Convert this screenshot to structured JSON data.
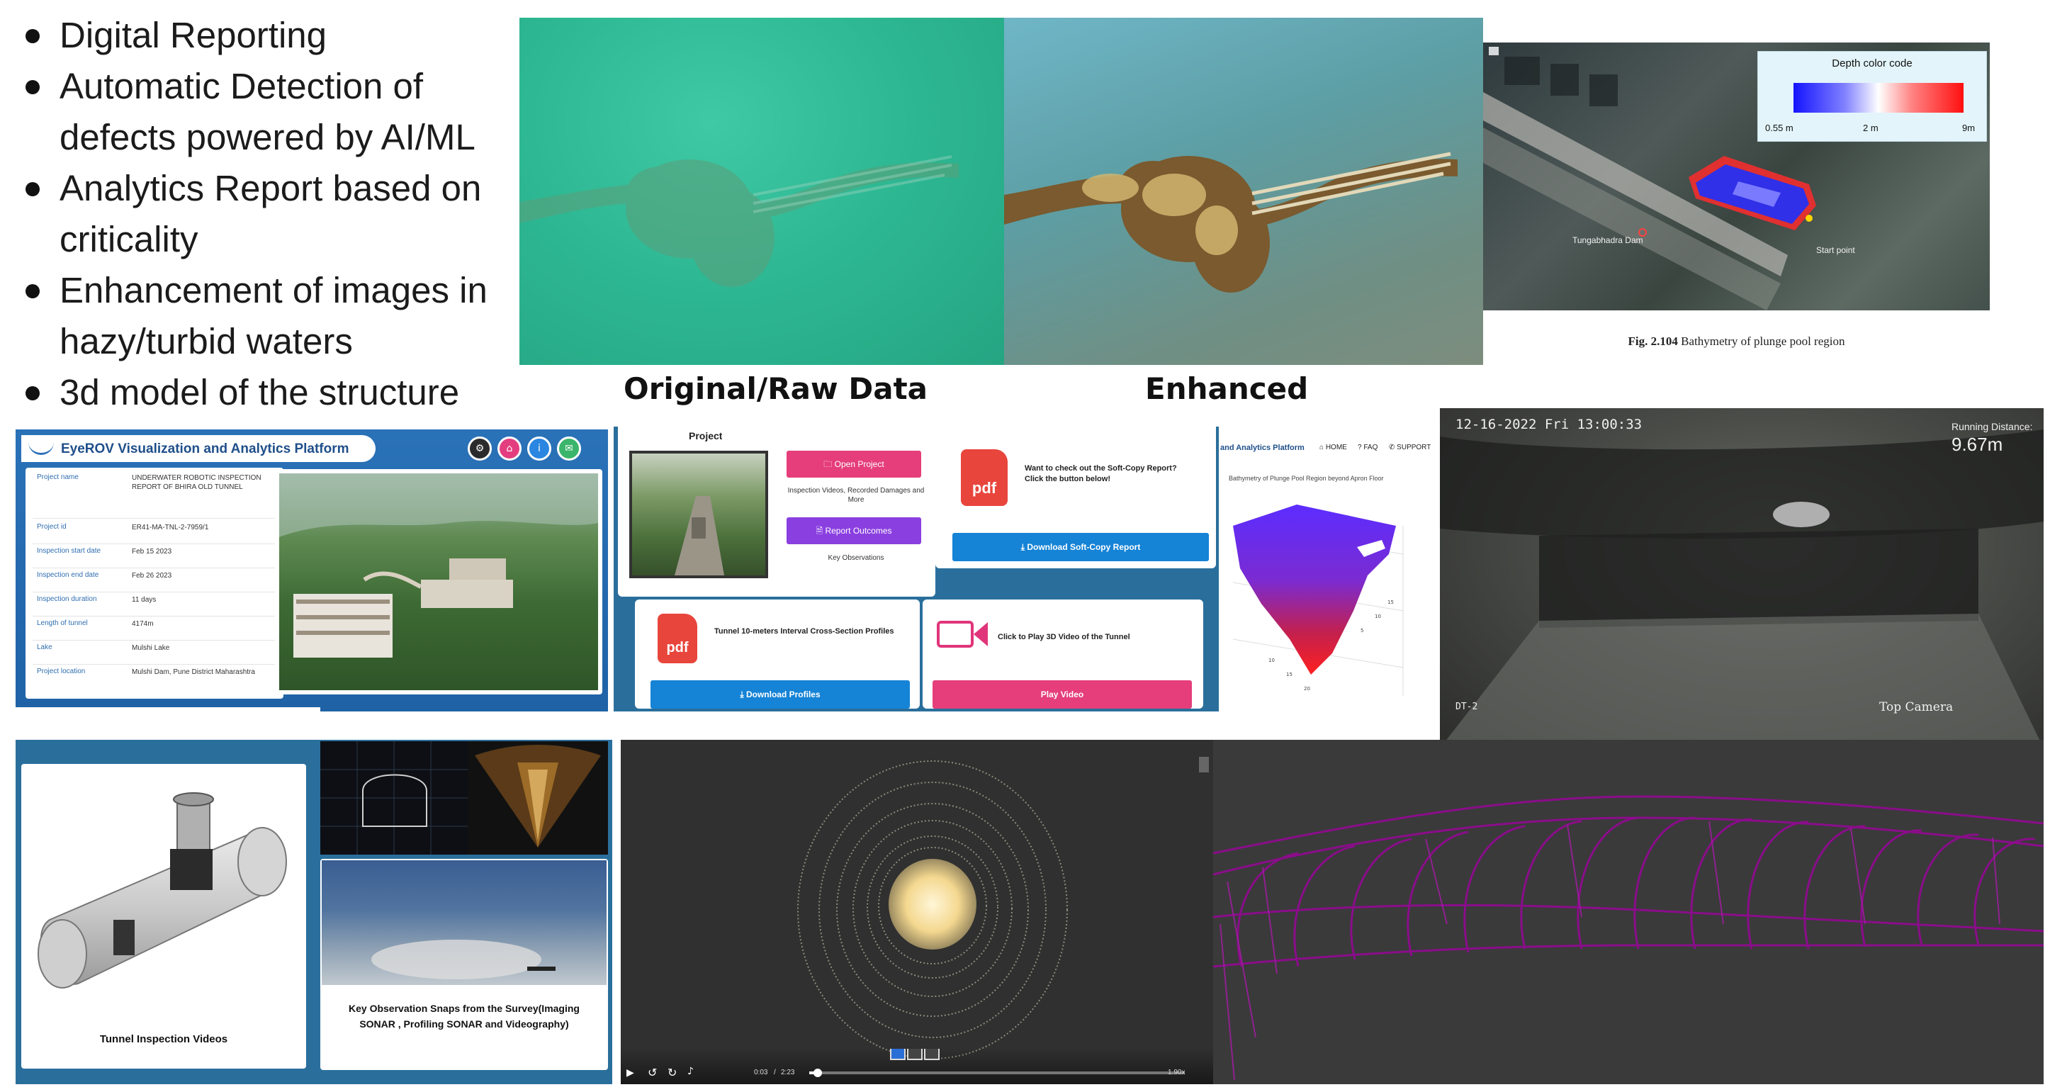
{
  "bullets": [
    "Digital Reporting",
    "Automatic Detection of defects powered by AI/ML",
    "Analytics Report based on criticality",
    "Enhancement of images in hazy/turbid waters",
    "3d model of the structure"
  ],
  "captions": {
    "raw": "Original/Raw Data",
    "enhanced": "Enhanced"
  },
  "bathymetry": {
    "legend_title": "Depth color code",
    "ticks": [
      "0.55 m",
      "2 m",
      "9m"
    ],
    "dam_label": "Tungabhadra Dam",
    "start_label": "Start point",
    "figure_caption_bold": "Fig. 2.104",
    "figure_caption": " Bathymetry of plunge pool region"
  },
  "platform": {
    "title": "EyeROV Visualization and Analytics Platform",
    "rows": [
      {
        "label": "Project name",
        "value": "UNDERWATER ROBOTIC INSPECTION REPORT OF BHIRA OLD TUNNEL"
      },
      {
        "label": "Project id",
        "value": "ER41-MA-TNL-2-7959/1"
      },
      {
        "label": "Inspection start date",
        "value": "Feb 15 2023"
      },
      {
        "label": "Inspection end date",
        "value": "Feb 26 2023"
      },
      {
        "label": "Inspection duration",
        "value": "11 days"
      },
      {
        "label": "Length of tunnel",
        "value": "4174m"
      },
      {
        "label": "Lake",
        "value": "Mulshi Lake"
      },
      {
        "label": "Project location",
        "value": "Mulshi Dam, Pune District Maharashtra"
      }
    ]
  },
  "project": {
    "heading": "Project",
    "open_btn": "Open Project",
    "open_desc": "Inspection Videos, Recorded Damages and More",
    "report_btn": "Report Outcomes",
    "report_desc": "Key Observations",
    "softcopy_text": "Want to check out the Soft-Copy Report? Click the button below!",
    "softcopy_btn": "Download Soft-Copy Report",
    "profiles_text": "Tunnel 10-meters Interval Cross-Section Profiles",
    "profiles_btn": "Download Profiles",
    "video_text": "Click to Play 3D Video of the Tunnel",
    "video_btn": "Play Video",
    "pdf_label": "pdf"
  },
  "plot3d": {
    "brand": "and Analytics Platform",
    "nav": [
      "HOME",
      "FAQ",
      "SUPPORT"
    ],
    "title": "Bathymetry of Plunge Pool Region beyond Apron Floor"
  },
  "camera": {
    "timestamp": "12-16-2022 Fri 13:00:33",
    "distance_label": "Running Distance:",
    "distance_value": "9.67m",
    "corner_label": "DT-2",
    "camera_label": "Top Camera"
  },
  "tunnel": {
    "videos_label": "Tunnel Inspection Videos",
    "snaps_label": "Key Observation Snaps from the Survey(Imaging SONAR , Profiling SONAR and Videography)"
  },
  "player": {
    "time_current": "0:03",
    "time_total": "2:23",
    "speed": "1.90x"
  }
}
